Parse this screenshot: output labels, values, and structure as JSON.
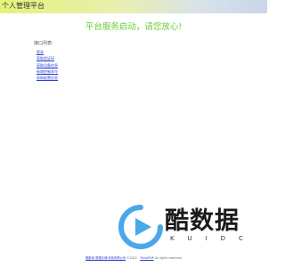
{
  "header": {
    "title": "个人管理平台"
  },
  "main": {
    "headline": "平台服务启动，请您放心!",
    "interfaces_heading": "接口列表:",
    "interfaces": [
      {
        "label": "登录"
      },
      {
        "label": "获取验证码"
      },
      {
        "label": "获取设备信息"
      },
      {
        "label": "新增控制命令"
      },
      {
        "label": "获取配置信息"
      }
    ]
  },
  "watermark": {
    "brand": "酷数据",
    "letters": "KUIDC"
  },
  "footer": {
    "company_link": "酷数库 数据存储·科技有限公司",
    "copyright": "©2022 -",
    "framework_link": "ThinkPHP",
    "rights": "All rights reserved"
  },
  "colors": {
    "headline": "#66cc33",
    "link": "#2a3fd1",
    "logo_blue": "#4aa8e8"
  }
}
